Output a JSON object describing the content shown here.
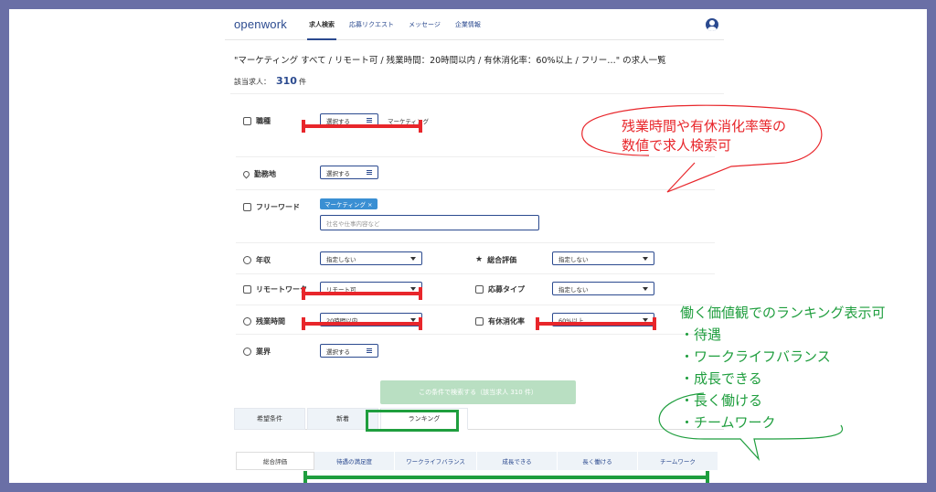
{
  "header": {
    "logo": "openwork",
    "nav": [
      "求人検索",
      "応募リクエスト",
      "メッセージ",
      "企業情報"
    ]
  },
  "page_title": "\"マーケティング すべて / リモート可 / 残業時間：20時間以内 / 有休消化率：60%以上 / フリー…\" の求人一覧",
  "result": {
    "label": "該当求人：",
    "count": "310",
    "unit": "件"
  },
  "form": {
    "job_type": {
      "label": "職種",
      "button": "選択する",
      "selected": "マーケティング"
    },
    "location": {
      "label": "勤務地",
      "button": "選択する"
    },
    "freeword": {
      "label": "フリーワード",
      "tag": "マーケティング ×",
      "placeholder": "社名や仕事内容など"
    },
    "salary": {
      "label": "年収",
      "value": "指定しない"
    },
    "rating": {
      "label": "総合評価",
      "value": "指定しない"
    },
    "remote": {
      "label": "リモートワーク",
      "value": "リモート可"
    },
    "apply_type": {
      "label": "応募タイプ",
      "value": "指定しない"
    },
    "overtime": {
      "label": "残業時間",
      "value": "20時間以内"
    },
    "paid_leave": {
      "label": "有休消化率",
      "value": "60%以上"
    },
    "industry": {
      "label": "業界",
      "button": "選択する"
    },
    "search_button": "この条件で検索する（該当求人 310 件）"
  },
  "tabs": [
    "希望条件",
    "新着",
    "ランキング"
  ],
  "ranking_tabs": [
    "総合評価",
    "待遇の満足度",
    "ワークライフバランス",
    "成長できる",
    "長く働ける",
    "チームワーク"
  ],
  "annotations": {
    "red_note": [
      "残業時間や有休消化率等の",
      "数値で求人検索可"
    ],
    "green_note": [
      "働く価値観でのランキング表示可",
      "・待遇",
      "・ワークライフバランス",
      "・成長できる",
      "・長く働ける",
      "・チームワーク"
    ]
  },
  "colors": {
    "brand": "#2b4a8f",
    "annotation_red": "#e8262b",
    "annotation_green": "#1f9e3e",
    "frame": "#6a6fa6"
  }
}
